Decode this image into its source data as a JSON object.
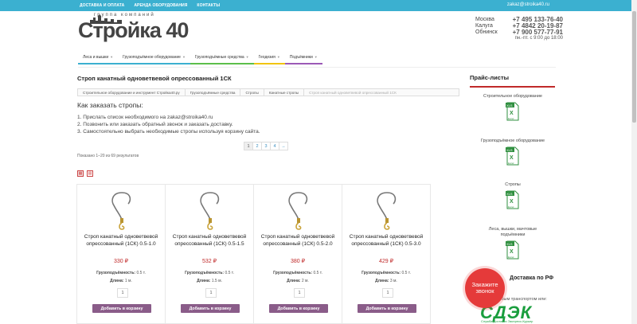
{
  "topbar": {
    "links": [
      "ДОСТАВКА И ОПЛАТА",
      "АРЕНДА ОБОРУДОВАНИЯ",
      "КОНТАКТЫ"
    ],
    "email": "zakaz@stroika40.ru"
  },
  "logo": {
    "tagline": "группа компаний",
    "name": "Стройка 40"
  },
  "contacts": {
    "phones": [
      {
        "city": "Москва",
        "phone": "+7 495 133-76-40"
      },
      {
        "city": "Калуга",
        "phone": "+7 4842 20-19-87"
      },
      {
        "city": "Обнинск",
        "phone": "+7 900 577-77-91"
      }
    ],
    "hours": "пн.-пт. с 9:00 до 18:00"
  },
  "nav": [
    {
      "label": "Леса и вышки",
      "color": "#3bb0d0"
    },
    {
      "label": "Грузоподъёмное оборудование",
      "color": "#3bb0d0"
    },
    {
      "label": "Грузоподъёмные средства",
      "color": "#5cbf4a"
    },
    {
      "label": "Геодезия",
      "color": "#f1c40f"
    },
    {
      "label": "Подъёмники",
      "color": "#9b59b6"
    }
  ],
  "page_title": "Строп канатный одноветвевой опрессованный 1СК",
  "breadcrumb": [
    "Строительное оборудование и инструмент Стройка40.ру",
    "Грузоподъёмные средства",
    "Стропы",
    "Канатные стропы",
    "Строп канатный одноветвевой опрессованный 1СК"
  ],
  "order": {
    "heading": "Как заказать стропы:",
    "steps": [
      "1. Прислать список необходимого на zakaz@stroika40.ru",
      "2. Позвонить или заказать обратный звонок и заказать доставку.",
      "3. Самостоятельно выбрать необходимые стропы используя корзину сайта."
    ]
  },
  "pager": [
    "1",
    "2",
    "3",
    "4",
    "→"
  ],
  "results_text": "Показано 1–20 из 69 результатов",
  "products": [
    {
      "name": "Строп канатный одноветвевой опрессованный (1СК) 0.5-1.0",
      "price": "330 ₽",
      "capacity_label": "Грузоподъёмность:",
      "capacity": "0.5 т.",
      "length_label": "Длина:",
      "length": "1 м.",
      "qty": "1",
      "button": "Добавить в корзину"
    },
    {
      "name": "Строп канатный одноветвевой опрессованный (1СК) 0.5-1.5",
      "price": "532 ₽",
      "capacity_label": "Грузоподъёмность:",
      "capacity": "0.5 т.",
      "length_label": "Длина:",
      "length": "1.5 м.",
      "qty": "1",
      "button": "Добавить в корзину"
    },
    {
      "name": "Строп канатный одноветвевой опрессованный (1СК) 0.5-2.0",
      "price": "380 ₽",
      "capacity_label": "Грузоподъёмность:",
      "capacity": "0.5 т.",
      "length_label": "Длина:",
      "length": "2 м.",
      "qty": "1",
      "button": "Добавить в корзину"
    },
    {
      "name": "Строп канатный одноветвевой опрессованный (1СК) 0.5-3.0",
      "price": "429 ₽",
      "capacity_label": "Грузоподъёмность:",
      "capacity": "0.5 т.",
      "length_label": "Длина:",
      "length": "3 м.",
      "qty": "1",
      "button": "Добавить в корзину"
    }
  ],
  "sidebar": {
    "title": "Прайс-листы",
    "items": [
      "Строительное оборудование",
      "Грузоподъёмное оборудование",
      "Стропы",
      "Леса, вышки, мачтовые подъёмники"
    ],
    "excel_label": "Excel",
    "delivery_title": "Доставка по РФ",
    "delivery_sub": "любым транспортом или:",
    "cdek": "СДЭК",
    "cdek_sub": "Служба Доставки Экспресс-Курьер"
  },
  "callback_bubble": "Закажите звонок",
  "colors": {
    "accent": "#3bb0d0",
    "price": "#c02a2a",
    "button": "#8a5c89",
    "callback": "#e53a3a"
  }
}
